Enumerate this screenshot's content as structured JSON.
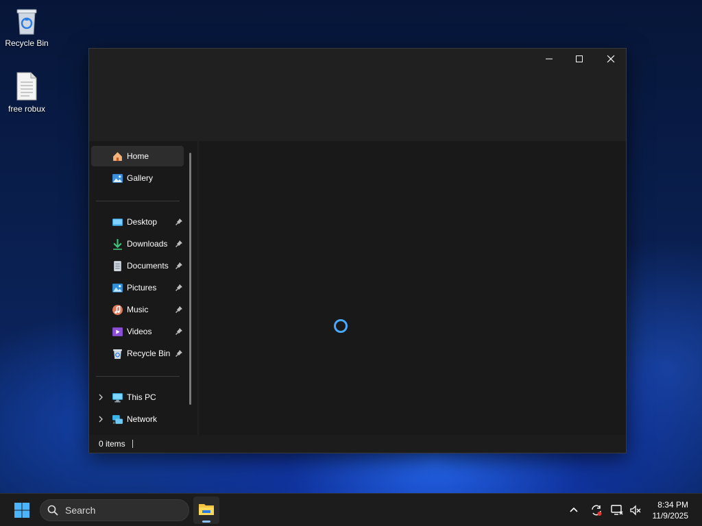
{
  "desktop": {
    "icons": [
      {
        "label": "Recycle Bin",
        "icon": "recycle-bin-icon"
      },
      {
        "label": "free robux",
        "icon": "text-file-icon"
      }
    ]
  },
  "window": {
    "caption": {
      "minimize": "—",
      "maximize": "☐",
      "close": "✕"
    },
    "sidebar": {
      "items": [
        {
          "label": "Home",
          "icon": "home-icon"
        },
        {
          "label": "Gallery",
          "icon": "gallery-icon"
        },
        {
          "label": "Desktop",
          "icon": "desktop-folder-icon"
        },
        {
          "label": "Downloads",
          "icon": "downloads-icon"
        },
        {
          "label": "Documents",
          "icon": "documents-icon"
        },
        {
          "label": "Pictures",
          "icon": "pictures-icon"
        },
        {
          "label": "Music",
          "icon": "music-icon"
        },
        {
          "label": "Videos",
          "icon": "videos-icon"
        },
        {
          "label": "Recycle Bin",
          "icon": "recycle-bin-icon"
        },
        {
          "label": "This PC",
          "icon": "this-pc-icon"
        },
        {
          "label": "Network",
          "icon": "network-icon"
        }
      ]
    },
    "status": {
      "item_count": "0 items"
    }
  },
  "taskbar": {
    "search_placeholder": "Search",
    "clock": {
      "time": "8:34 PM",
      "date": "11/9/2025"
    }
  },
  "colors": {
    "accent": "#4aa8ff",
    "window_bg": "#191919",
    "titlebar_bg": "#202020",
    "selected_bg": "#2d2d2d"
  }
}
